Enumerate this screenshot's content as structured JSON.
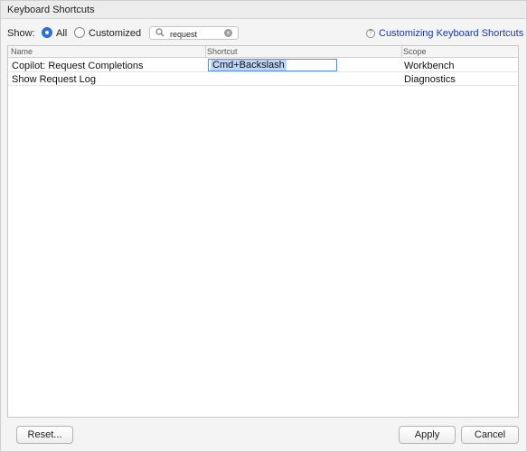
{
  "window": {
    "title": "Keyboard Shortcuts"
  },
  "filter": {
    "show_label": "Show:",
    "options": [
      {
        "label": "All",
        "selected": true
      },
      {
        "label": "Customized",
        "selected": false
      }
    ],
    "search_value": "request",
    "help_link": "Customizing Keyboard Shortcuts"
  },
  "table": {
    "columns": [
      "Name",
      "Shortcut",
      "Scope"
    ],
    "rows": [
      {
        "name": "Copilot: Request Completions",
        "shortcut": "Cmd+Backslash",
        "scope": "Workbench",
        "editing": true
      },
      {
        "name": "Show Request Log",
        "shortcut": "",
        "scope": "Diagnostics",
        "editing": false
      }
    ]
  },
  "buttons": {
    "reset": "Reset...",
    "apply": "Apply",
    "cancel": "Cancel"
  },
  "colors": {
    "accent": "#2a6fd6",
    "link": "#1a3a9c",
    "selection": "#bcd4f5"
  }
}
